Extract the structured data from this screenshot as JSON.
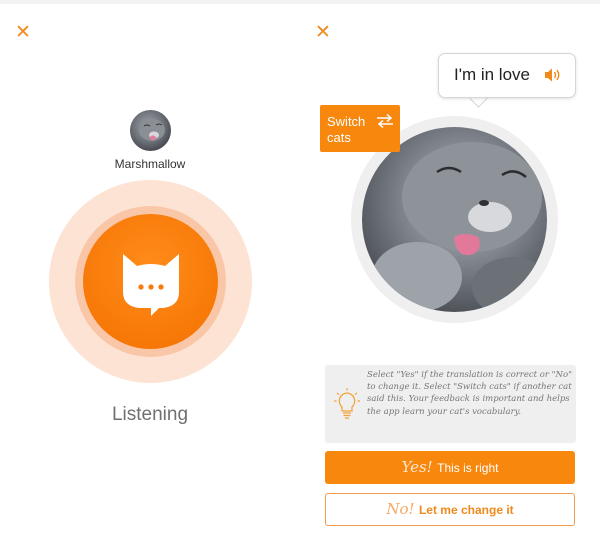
{
  "listening_screen": {
    "close_icon": "close-x-icon",
    "cat_name": "Marshmallow",
    "status": "Listening",
    "mic_icon": "cat-face-chat-icon"
  },
  "translation_screen": {
    "close_icon": "close-x-icon",
    "translation": "I'm in love",
    "speaker_icon": "speaker-sound-icon",
    "switch_cats": {
      "label": "Switch cats",
      "icon": "swap-arrows-icon"
    },
    "tip": {
      "icon": "lightbulb-icon",
      "text": "Select \"Yes\" if the translation is correct or \"No\" to change it. Select \"Switch cats\" if another cat said this. Your feedback is important and helps the app learn your cat's vocabulary."
    },
    "yes_button": {
      "hand": "Yes!",
      "label": "This is right"
    },
    "no_button": {
      "hand": "No!",
      "label": "Let me change it"
    }
  },
  "colors": {
    "accent": "#f8870e",
    "ring_outer": "#fde3d3",
    "ring_inner": "#f9c7a7",
    "tip_bg": "#efefef",
    "status_text": "#707070"
  }
}
